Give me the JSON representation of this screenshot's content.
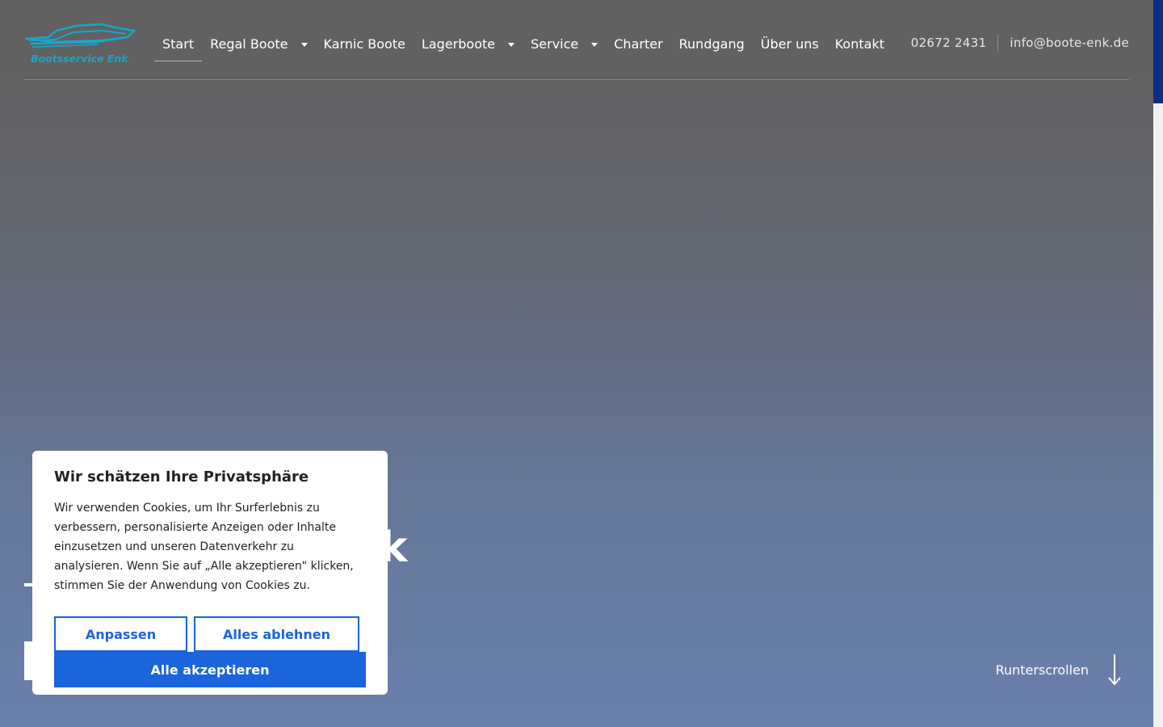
{
  "brand": {
    "logo_text": "Bootsservice Enk",
    "logo_color": "#1aa6c9"
  },
  "nav": {
    "items": [
      {
        "label": "Start",
        "has_dropdown": false,
        "active": true
      },
      {
        "label": "Regal Boote",
        "has_dropdown": true,
        "active": false
      },
      {
        "label": "Karnic Boote",
        "has_dropdown": false,
        "active": false
      },
      {
        "label": "Lagerboote",
        "has_dropdown": true,
        "active": false
      },
      {
        "label": "Service",
        "has_dropdown": true,
        "active": false
      },
      {
        "label": "Charter",
        "has_dropdown": false,
        "active": false
      },
      {
        "label": "Rundgang",
        "has_dropdown": false,
        "active": false
      },
      {
        "label": "Über uns",
        "has_dropdown": false,
        "active": false
      },
      {
        "label": "Kontakt",
        "has_dropdown": false,
        "active": false
      }
    ]
  },
  "contact": {
    "phone": "02672 2431",
    "email": "info@boote-enk.de"
  },
  "hero": {
    "title_visible": "k",
    "scroll_label": "Runterscrollen"
  },
  "cookie": {
    "title": "Wir schätzen Ihre Privatsphäre",
    "text": "Wir verwenden Cookies, um Ihr Surferlebnis zu verbessern, personalisierte Anzeigen oder Inhalte einzusetzen und unseren Datenverkehr zu analysieren. Wenn Sie auf „Alle akzeptieren\" klicken, stimmen Sie der Anwendung von Cookies zu.",
    "customize_label": "Anpassen",
    "reject_label": "Alles ablehnen",
    "accept_label": "Alle akzeptieren",
    "accent_color": "#1a64dc"
  }
}
